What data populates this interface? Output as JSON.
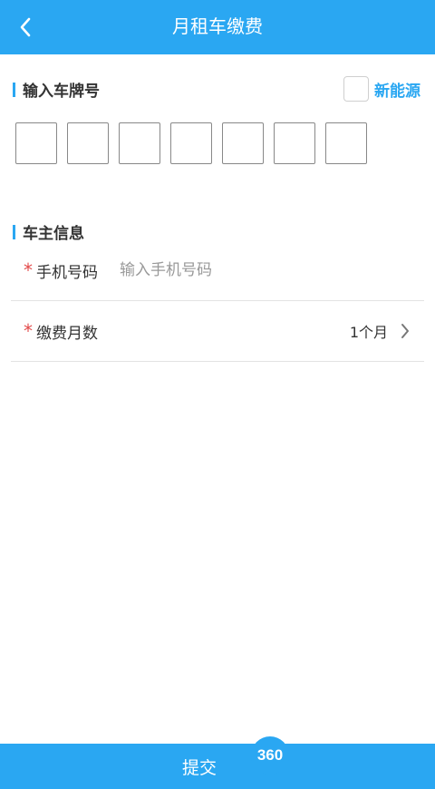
{
  "header": {
    "title": "月租车缴费",
    "back_icon": "chevron-left-icon"
  },
  "plate": {
    "section_label": "输入车牌号",
    "new_energy_label": "新能源",
    "boxes": [
      "",
      "",
      "",
      "",
      "",
      "",
      ""
    ]
  },
  "owner": {
    "section_label": "车主信息",
    "phone": {
      "required_mark": "*",
      "label": "手机号码",
      "placeholder": "输入手机号码",
      "value": ""
    },
    "months": {
      "required_mark": "*",
      "label": "缴费月数",
      "value": "1个月"
    }
  },
  "footer": {
    "submit_label": "提交",
    "badge_text": "360"
  },
  "colors": {
    "accent": "#2aa7f2",
    "required": "#e24a4a"
  }
}
